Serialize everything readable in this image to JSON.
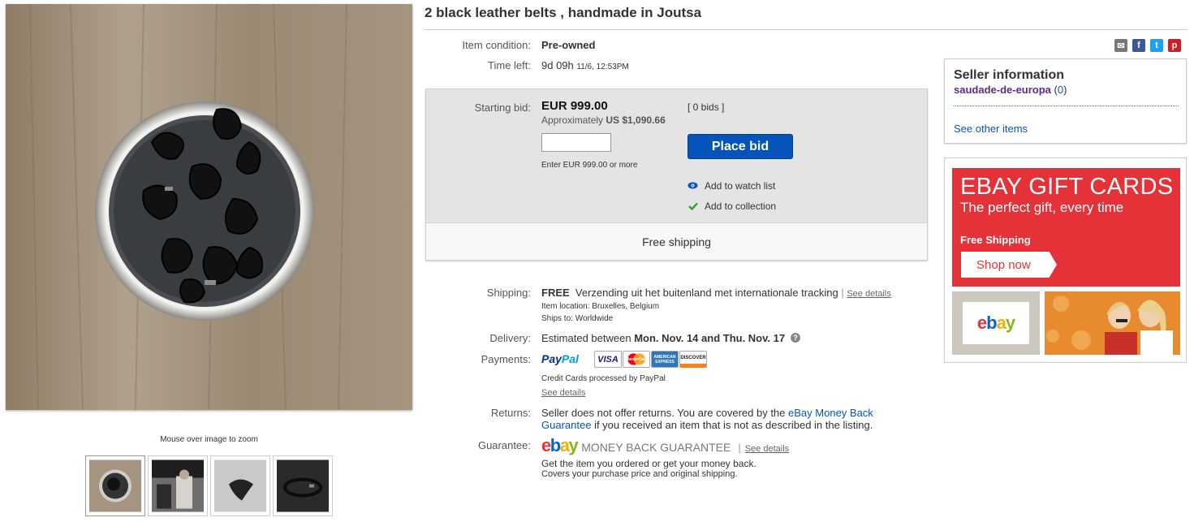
{
  "item": {
    "title": "2 black leather belts , handmade in Joutsa",
    "condition_label": "Item condition:",
    "condition_value": "Pre-owned",
    "time_label": "Time left:",
    "time_value": "9d 09h",
    "time_end": "11/6, 12:53PM"
  },
  "bid": {
    "starting_label": "Starting bid:",
    "amount": "EUR 999.00",
    "approx_prefix": "Approximately",
    "approx_value": "US $1,090.66",
    "bids_link": "[ 0 bids ]",
    "input_value": "",
    "enter_hint": "Enter EUR 999.00 or more",
    "place_bid_label": "Place bid",
    "watch_label": "Add to watch list",
    "collection_label": "Add to collection",
    "free_shipping_bar": "Free shipping"
  },
  "shipping": {
    "label": "Shipping:",
    "free": "FREE",
    "service": "Verzending uit het buitenland met internationale tracking",
    "sep": "|",
    "see_details": "See details",
    "location": "Item location:  Bruxelles, Belgium",
    "ships_to": "Ships to:  Worldwide"
  },
  "delivery": {
    "label": "Delivery:",
    "prefix": "Estimated between",
    "range": "Mon. Nov. 14 and Thu. Nov. 17",
    "help": "?"
  },
  "payments": {
    "label": "Payments:",
    "paypal_a": "Pay",
    "paypal_b": "Pal",
    "cards": [
      "VISA",
      "MasterCard",
      "AMERICAN EXPRESS",
      "DISCOVER"
    ],
    "note": "Credit Cards processed by PayPal",
    "see_details": "See details"
  },
  "returns": {
    "label": "Returns:",
    "text_a": "Seller does not offer returns. You are covered by the",
    "link_a": "eBay Money Back",
    "link_b": "Guarantee",
    "text_b": "if you received an item that is not as described in the listing."
  },
  "guarantee": {
    "label": "Guarantee:",
    "logo_text": "ebay",
    "mbg": "MONEY BACK GUARANTEE",
    "sep": "|",
    "see_details": "See details",
    "line1": "Get the item you ordered or get your money back.",
    "line2": "Covers your purchase price and original shipping."
  },
  "gallery": {
    "zoom_hint": "Mouse over image to zoom"
  },
  "seller": {
    "title": "Seller information",
    "name": "saudade-de-europa",
    "feedback_open": "(",
    "feedback": "0",
    "feedback_close": ")",
    "other_items": "See other items"
  },
  "ad": {
    "headline": "EBAY GIFT CARDS",
    "subhead": "The perfect gift, every time",
    "free_shipping": "Free Shipping",
    "cta": "Shop now",
    "card_logo": "ebay"
  },
  "share": [
    "email-icon",
    "facebook-icon",
    "twitter-icon",
    "pinterest-icon"
  ],
  "colors": {
    "link": "#0654ba",
    "seller": "#5b2a8c",
    "ebay_red": "#e53238",
    "ebay_blue": "#0064d2",
    "ebay_yellow": "#f5af02",
    "ebay_green": "#86b817"
  }
}
